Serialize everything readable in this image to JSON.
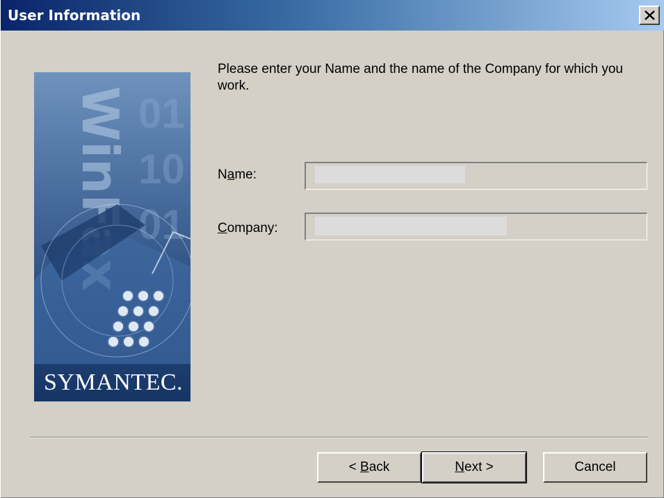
{
  "window": {
    "title": "User Information"
  },
  "banner": {
    "brand": "SYMANTEC."
  },
  "intro_text": "Please enter your Name and the name of the Company for which you work.",
  "form": {
    "name": {
      "label_pre": "N",
      "label_key": "a",
      "label_post": "me:",
      "value": ""
    },
    "company": {
      "label_pre": "",
      "label_key": "C",
      "label_post": "ompany:",
      "value": ""
    }
  },
  "buttons": {
    "back": {
      "pre": "< ",
      "key": "B",
      "post": "ack"
    },
    "next": {
      "pre": "",
      "key": "N",
      "post": "ext >"
    },
    "cancel": {
      "label": "Cancel"
    }
  },
  "colors": {
    "title_start": "#0a246a",
    "title_end": "#a6caf0",
    "face": "#d4d0c8",
    "banner": "#2d5289"
  }
}
